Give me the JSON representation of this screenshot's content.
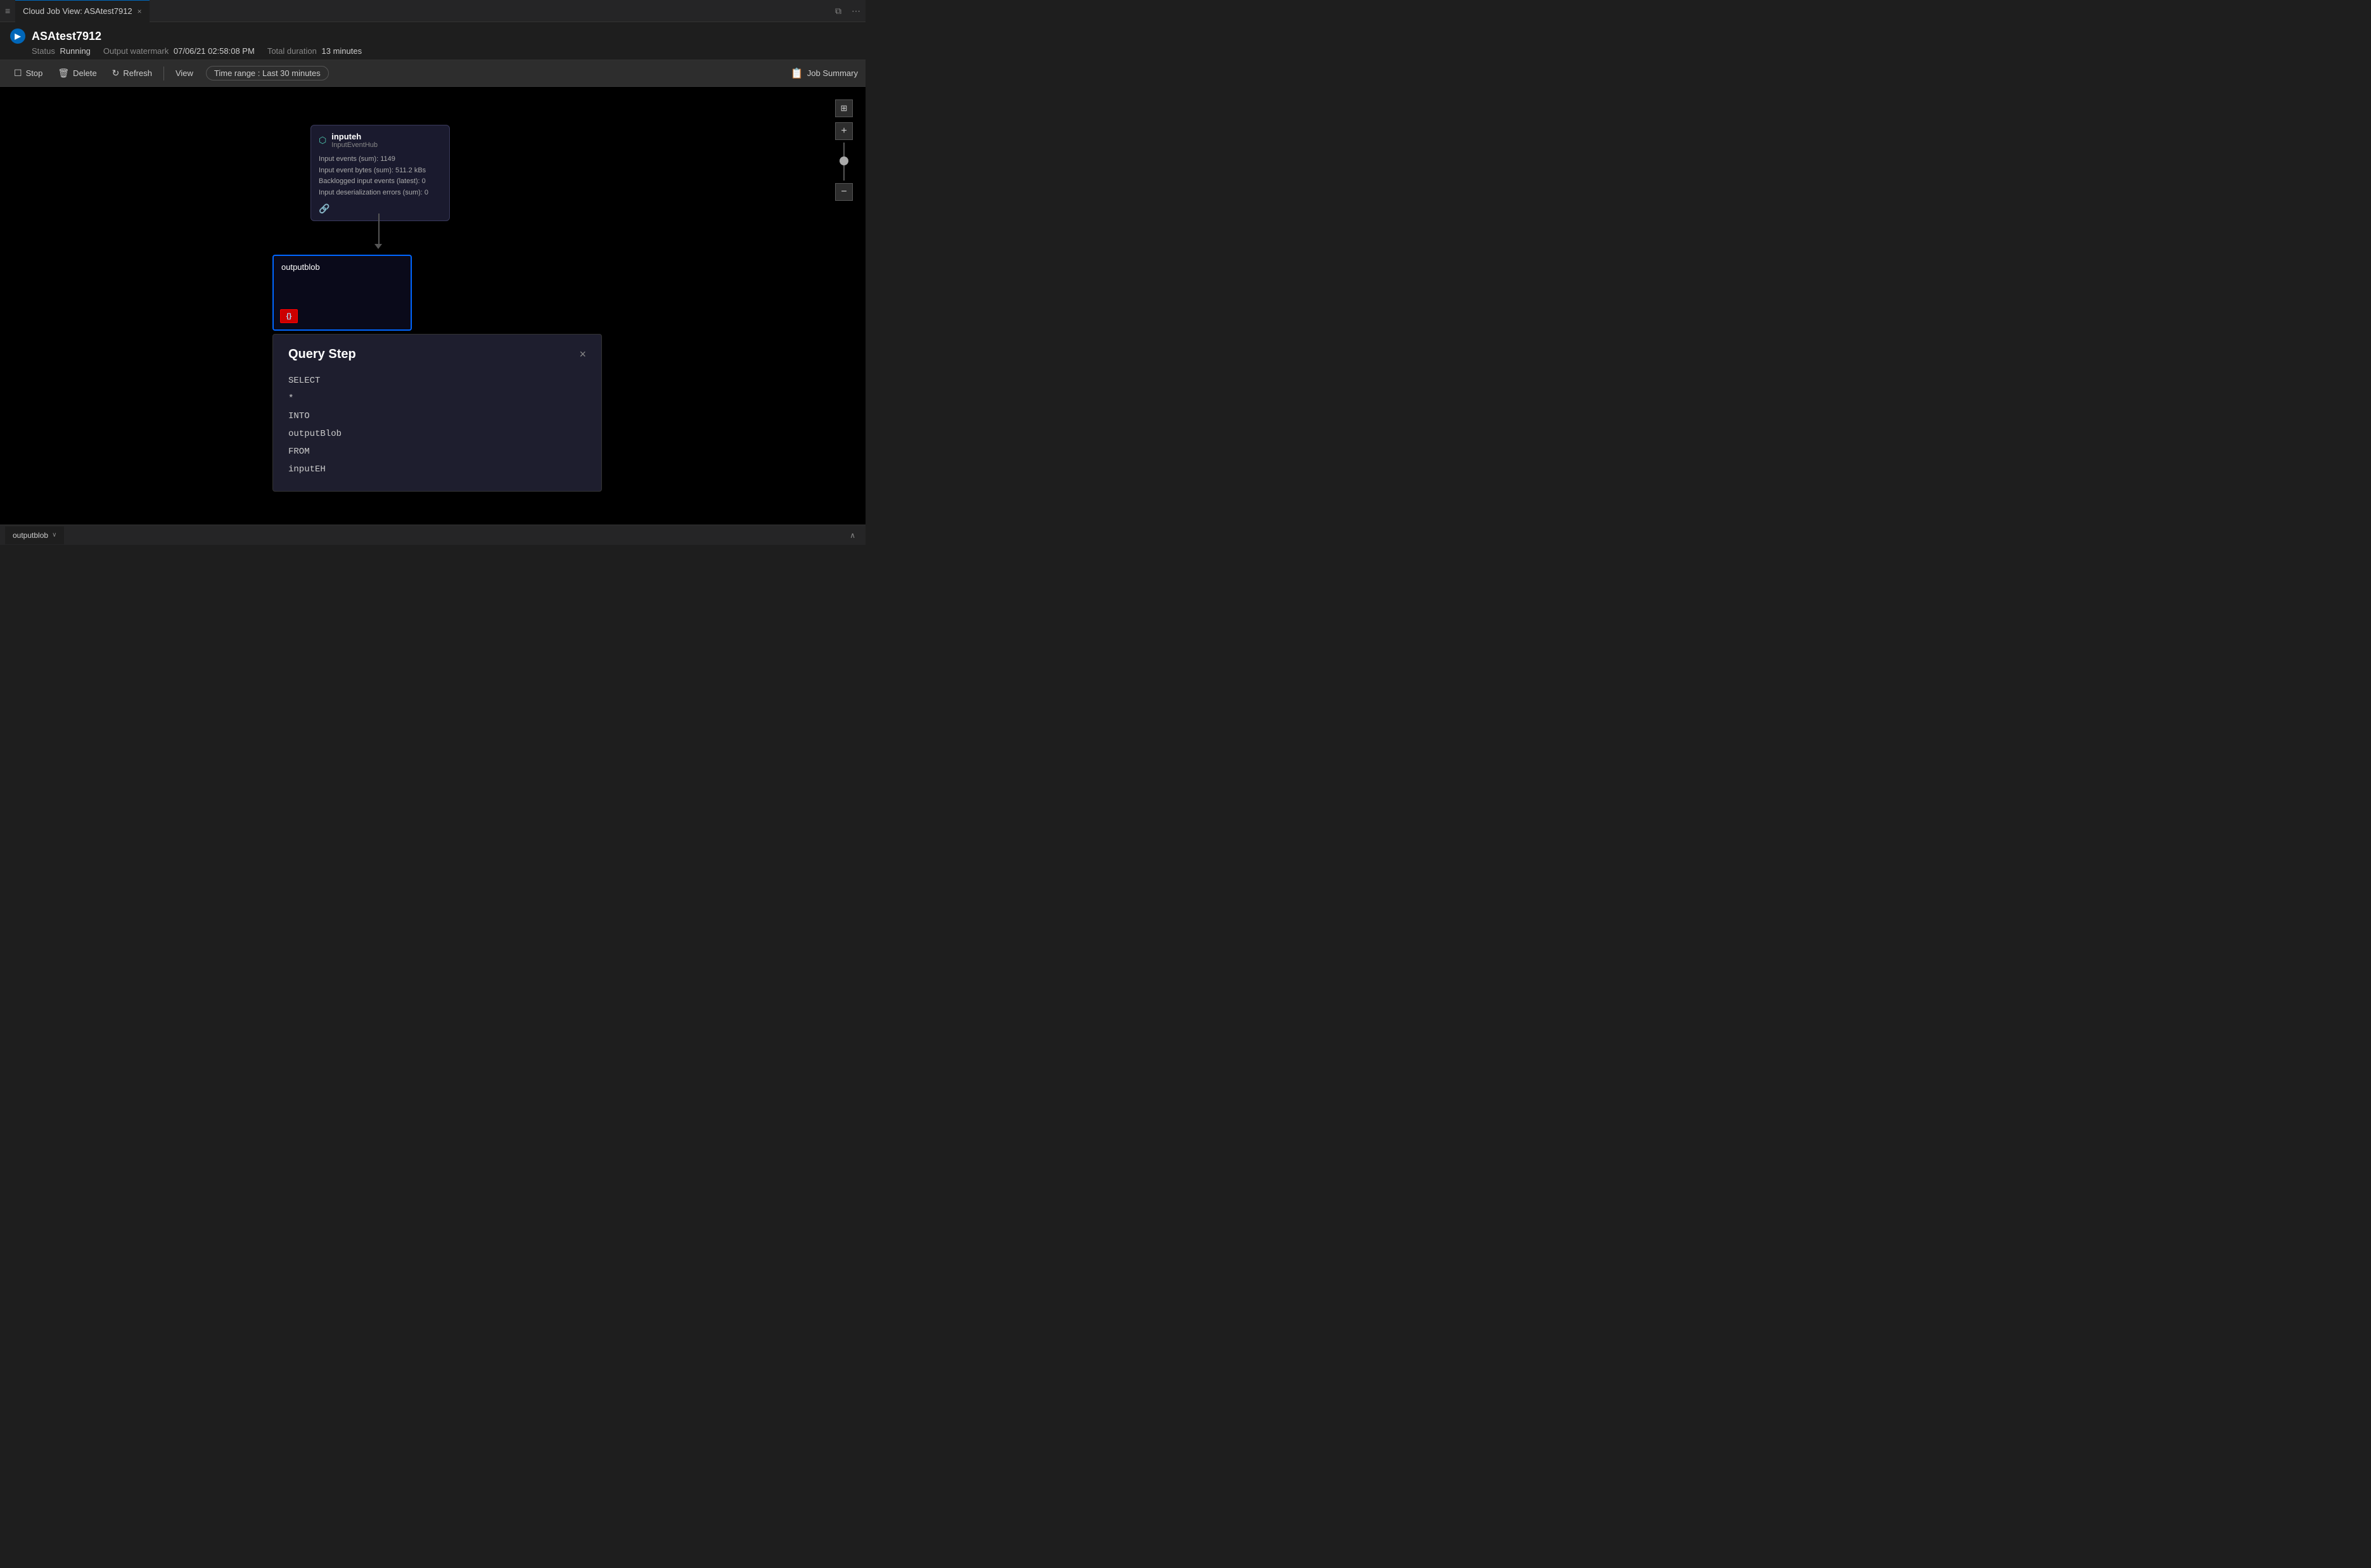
{
  "tab": {
    "icon": "≡",
    "title": "Cloud Job View: ASAtest7912",
    "close_label": "×"
  },
  "window_controls": {
    "split_icon": "⧉",
    "menu_icon": "⋯"
  },
  "title_bar": {
    "icon_label": "▶",
    "job_name": "ASAtest7912",
    "status_label": "Status",
    "status_value": "Running",
    "watermark_label": "Output watermark",
    "watermark_value": "07/06/21 02:58:08 PM",
    "duration_label": "Total duration",
    "duration_value": "13 minutes"
  },
  "toolbar": {
    "stop_label": "Stop",
    "delete_label": "Delete",
    "refresh_label": "Refresh",
    "view_label": "View",
    "time_range_label": "Time range :  Last 30 minutes",
    "job_summary_label": "Job Summary"
  },
  "nodes": {
    "input": {
      "title": "inputeh",
      "subtitle": "InputEventHub",
      "stats": [
        "Input events (sum): 1149",
        "Input event bytes (sum): 511.2 kBs",
        "Backlogged input events (latest): 0",
        "Input deserialization errors (sum): 0"
      ],
      "icon": "⬡"
    },
    "output": {
      "title": "outputblob",
      "icon_label": "{}"
    }
  },
  "query_panel": {
    "title": "Query Step",
    "close_label": "×",
    "lines": [
      "SELECT",
      "*",
      "INTO",
      "outputBlob",
      "FROM",
      "inputEH"
    ]
  },
  "zoom_controls": {
    "fit_label": "⊞",
    "plus_label": "+",
    "minus_label": "−"
  },
  "bottom_tab": {
    "label": "outputblob",
    "chevron": "∨",
    "chevron_right": "∧"
  }
}
